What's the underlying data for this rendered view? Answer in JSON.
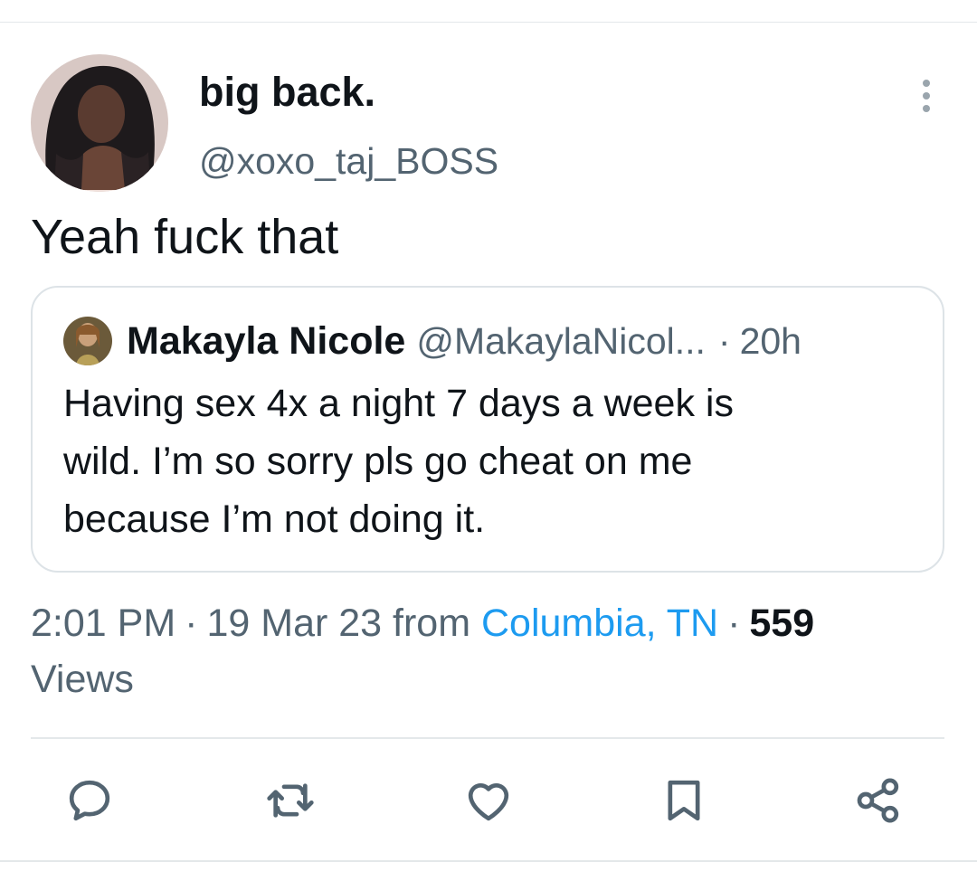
{
  "tweet": {
    "author": {
      "display_name": "big back.",
      "handle": "@xoxo_taj_BOSS"
    },
    "text": "Yeah fuck that",
    "quoted": {
      "display_name": "Makayla Nicole",
      "handle": "@MakaylaNicol...",
      "separator": "·",
      "time": "20h",
      "text_lines": [
        "Having sex 4x a night 7 days a week is",
        "wild. I’m so sorry pls go cheat on me",
        "because I’m not doing it."
      ]
    },
    "meta": {
      "time": "2:01 PM",
      "date": "19 Mar 23",
      "from_label": "from",
      "location": "Columbia, TN",
      "separator": "·",
      "views_count": "559",
      "views_label": "Views"
    }
  },
  "icons": {
    "more": "more-vertical-icon",
    "reply": "reply-icon",
    "retweet": "retweet-icon",
    "like": "heart-icon",
    "bookmark": "bookmark-icon",
    "share": "share-icon"
  },
  "colors": {
    "text": "#0f1419",
    "secondary": "#536471",
    "link": "#1d9bf0",
    "divider": "#e4e8ea"
  }
}
